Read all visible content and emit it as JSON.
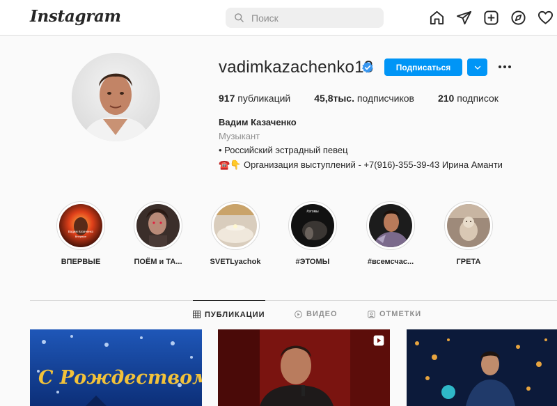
{
  "topbar": {
    "logo_text": "Instagram",
    "search_placeholder": "Поиск",
    "icons": [
      "home-icon",
      "direct-icon",
      "new-post-icon",
      "explore-icon",
      "activity-icon"
    ]
  },
  "profile": {
    "username": "vadimkazachenko13",
    "verified": true,
    "follow_label": "Подписаться",
    "stats": {
      "posts_count": "917",
      "posts_label": "публикаций",
      "followers_count": "45,8тыс.",
      "followers_label": "подписчиков",
      "following_count": "210",
      "following_label": "подписок"
    },
    "full_name": "Вадим Казаченко",
    "category": "Музыкант",
    "bio_line1": "• Российский эстрадный певец",
    "bio_line2": "☎️👇 Организация выступлений - +7(916)-355-39-43 Ирина Аманти"
  },
  "highlights": [
    {
      "label": "ВПЕРВЫЕ"
    },
    {
      "label": "ПОЁМ и ТА..."
    },
    {
      "label": "SVETLyachok"
    },
    {
      "label": "#ЭТОМЫ"
    },
    {
      "label": "#всемсчас..."
    },
    {
      "label": "ГРЕТА"
    }
  ],
  "highlight_images": {
    "h1_title": "Вадим Казаченко",
    "h1_sub": "Впервые",
    "h4_text": "#этомы"
  },
  "tabs": [
    {
      "label": "ПУБЛИКАЦИИ",
      "active": true
    },
    {
      "label": "ВИДЕО",
      "active": false
    },
    {
      "label": "ОТМЕТКИ",
      "active": false
    }
  ],
  "posts": {
    "post1_text": "С Рождеством!"
  },
  "colors": {
    "accent": "#0095f6",
    "verified": "#3897f0",
    "border": "#dbdbdb",
    "muted": "#8e8e8e"
  }
}
